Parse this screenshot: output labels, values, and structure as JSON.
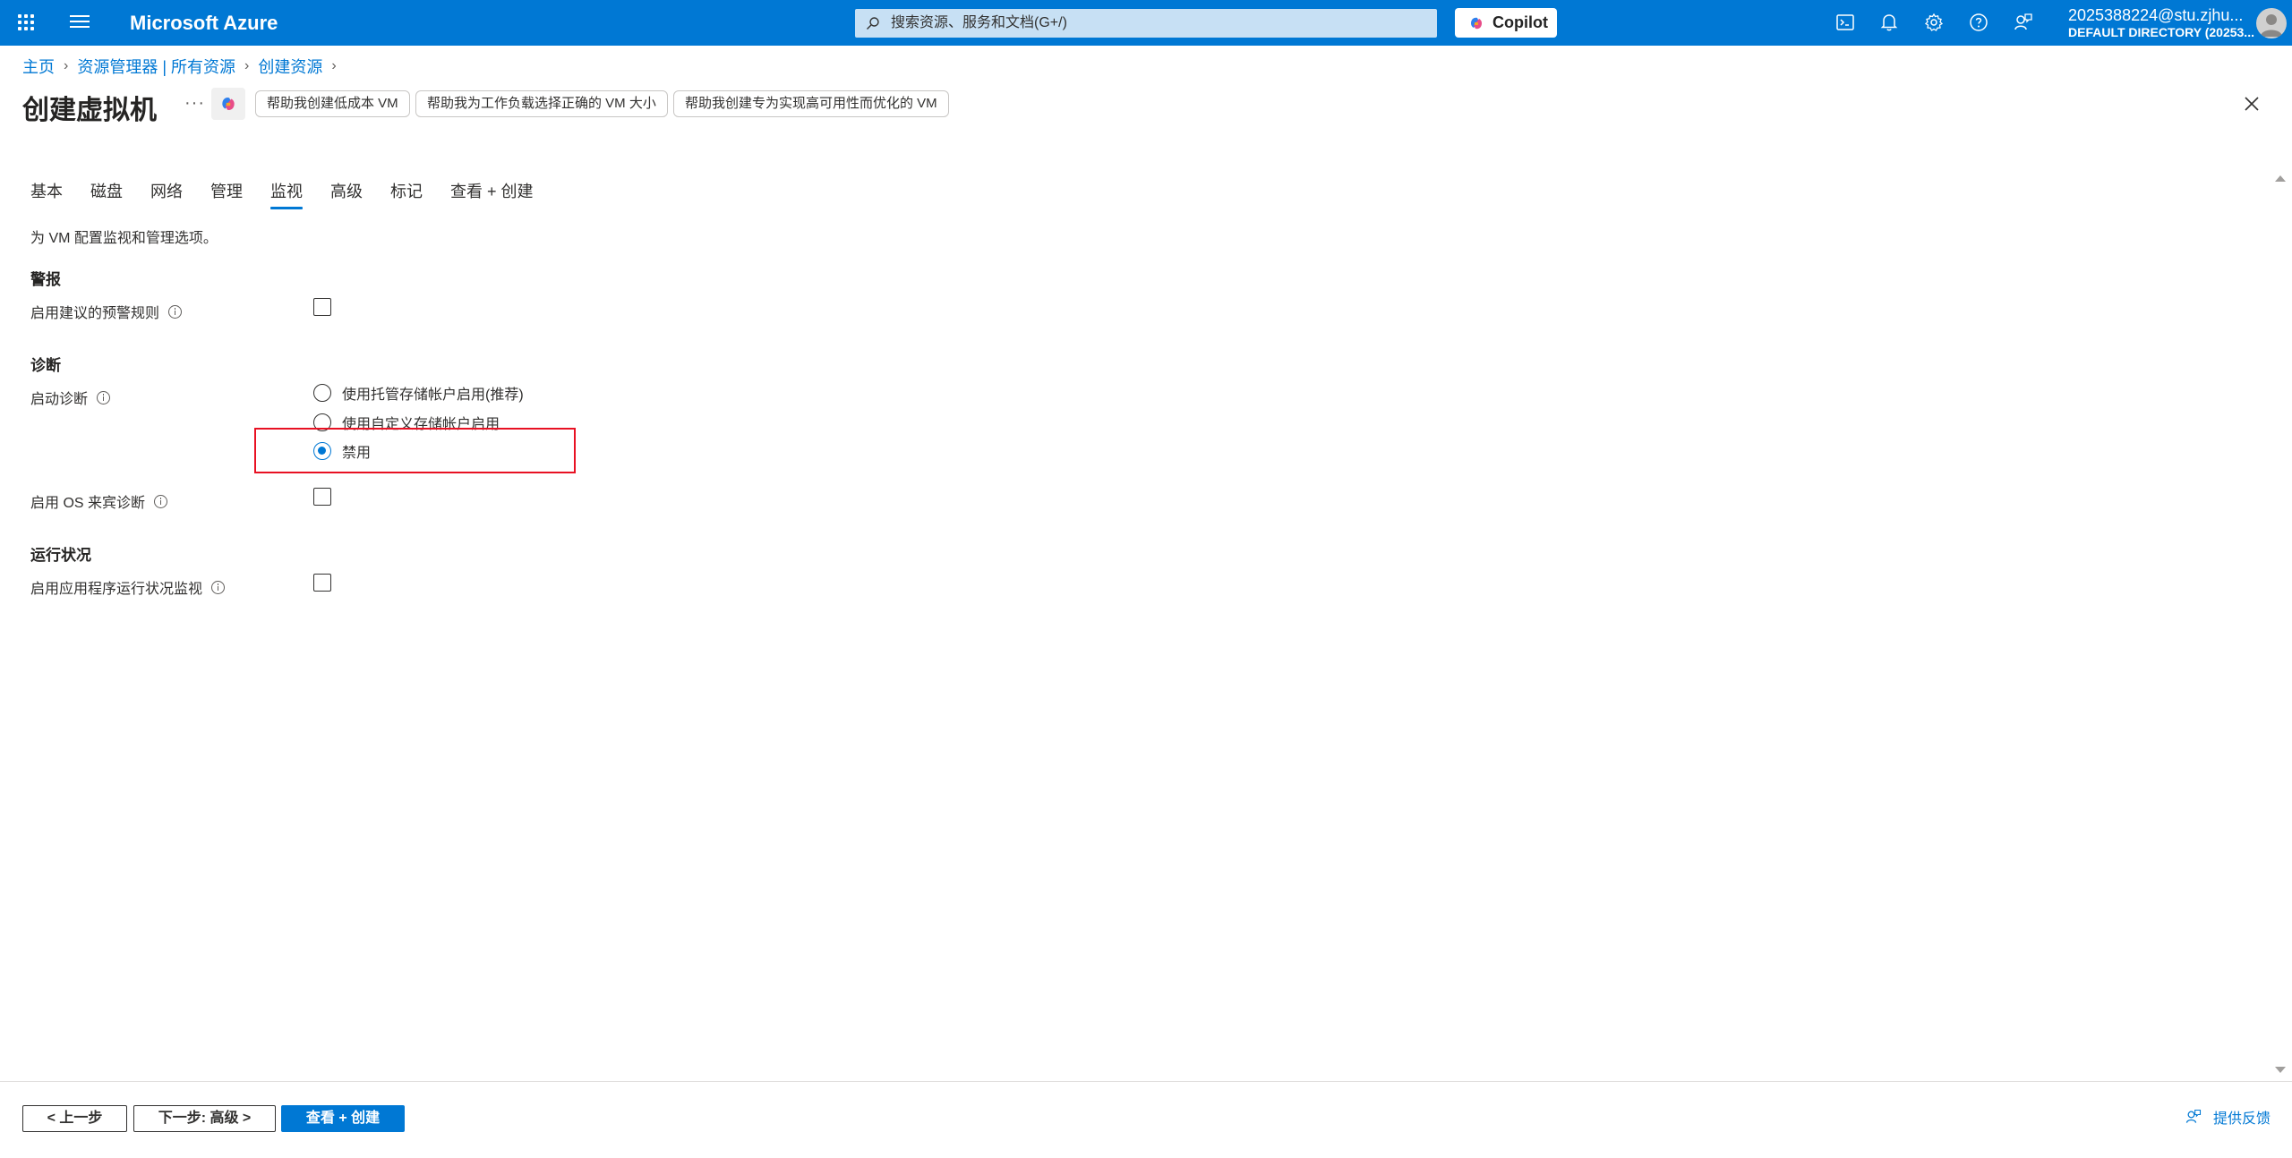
{
  "topbar": {
    "brand": "Microsoft Azure",
    "search_placeholder": "搜索资源、服务和文档(G+/)",
    "copilot_label": "Copilot",
    "user_email": "2025388224@stu.zjhu...",
    "user_directory": "DEFAULT DIRECTORY (20253...",
    "accent_color": "#0078d4"
  },
  "breadcrumb": {
    "items": [
      "主页",
      "资源管理器 | 所有资源",
      "创建资源"
    ]
  },
  "header": {
    "title": "创建虚拟机",
    "more_label": "···",
    "suggestions": [
      "帮助我创建低成本 VM",
      "帮助我为工作负载选择正确的 VM 大小",
      "帮助我创建专为实现高可用性而优化的 VM"
    ]
  },
  "tabs": [
    "基本",
    "磁盘",
    "网络",
    "管理",
    "监视",
    "高级",
    "标记",
    "查看 + 创建"
  ],
  "active_tab": "监视",
  "main": {
    "description": "为 VM 配置监视和管理选项。",
    "alerts": {
      "heading": "警报",
      "enable_alert_rules_label": "启用建议的预警规则",
      "enable_alert_rules_checked": false
    },
    "diagnostics": {
      "heading": "诊断",
      "boot_diagnostics_label": "启动诊断",
      "options": [
        "使用托管存储帐户启用(推荐)",
        "使用自定义存储帐户启用",
        "禁用"
      ],
      "selected_option": "禁用",
      "os_guest_label": "启用 OS 来宾诊断",
      "os_guest_checked": false
    },
    "health": {
      "heading": "运行状况",
      "app_health_label": "启用应用程序运行状况监视",
      "app_health_checked": false
    }
  },
  "footer": {
    "prev_label": "< 上一步",
    "next_label": "下一步: 高级 >",
    "review_label": "查看 + 创建",
    "feedback_label": "提供反馈"
  }
}
